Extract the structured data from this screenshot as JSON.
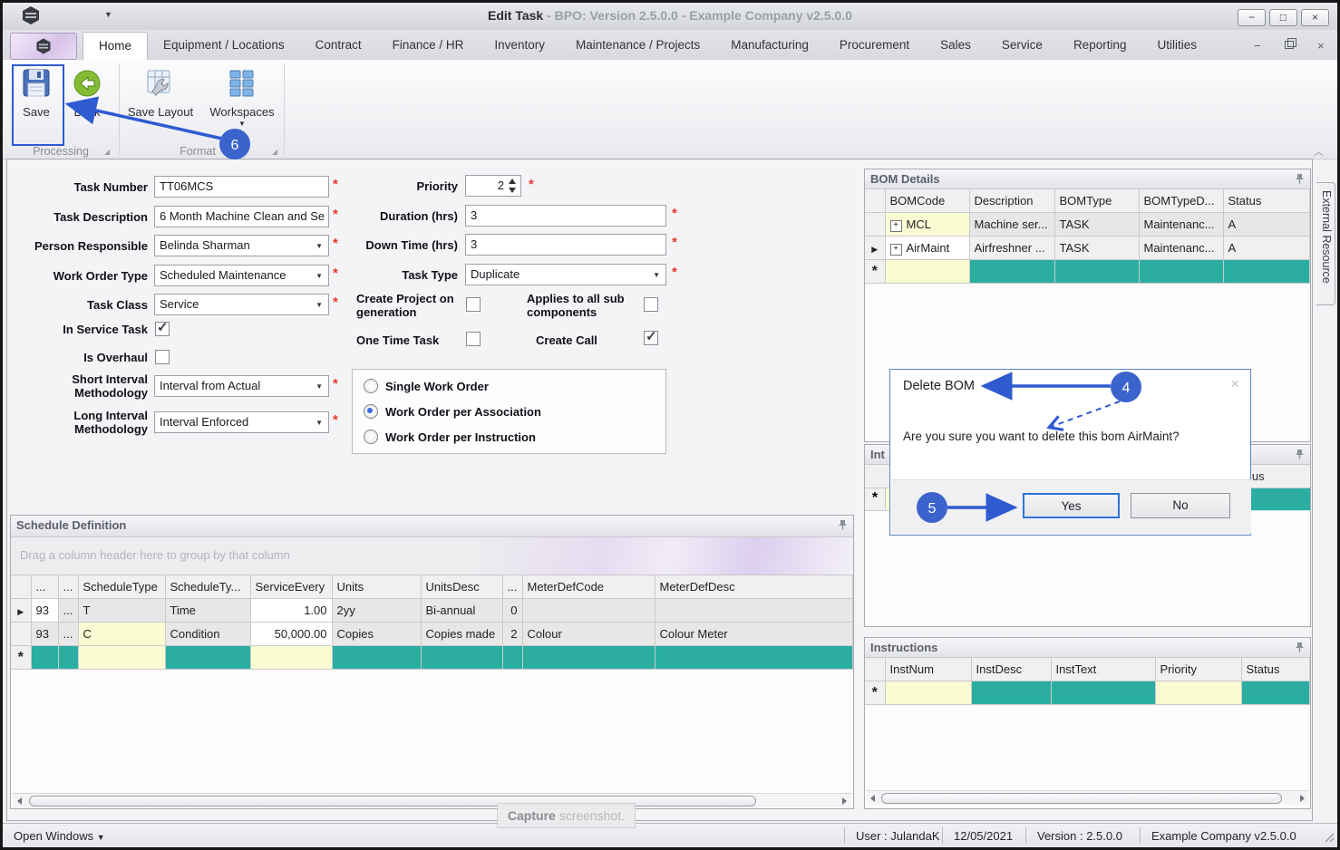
{
  "window": {
    "title_primary": "Edit Task",
    "title_rest": " - BPO: Version 2.5.0.0 - Example Company v2.5.0.0"
  },
  "ribbon": {
    "tabs": [
      "Home",
      "Equipment / Locations",
      "Contract",
      "Finance / HR",
      "Inventory",
      "Maintenance / Projects",
      "Manufacturing",
      "Procurement",
      "Sales",
      "Service",
      "Reporting",
      "Utilities"
    ],
    "active_tab": "Home",
    "save_label": "Save",
    "back_label": "Back",
    "save_layout_label": "Save Layout",
    "workspaces_label": "Workspaces",
    "group_processing": "Processing",
    "group_format": "Format"
  },
  "form": {
    "task_number": {
      "label": "Task Number",
      "value": "TT06MCS"
    },
    "task_description": {
      "label": "Task Description",
      "value": "6 Month Machine Clean and Se"
    },
    "person_responsible": {
      "label": "Person Responsible",
      "value": "Belinda Sharman"
    },
    "work_order_type": {
      "label": "Work Order Type",
      "value": "Scheduled Maintenance"
    },
    "task_class": {
      "label": "Task Class",
      "value": "Service"
    },
    "in_service_task": {
      "label": "In Service Task",
      "checked": true
    },
    "is_overhaul": {
      "label": "Is Overhaul",
      "checked": false
    },
    "short_interval": {
      "label": "Short Interval Methodology",
      "value": "Interval from Actual"
    },
    "long_interval": {
      "label": "Long Interval Methodology",
      "value": "Interval Enforced"
    },
    "priority": {
      "label": "Priority",
      "value": "2"
    },
    "duration": {
      "label": "Duration (hrs)",
      "value": "3"
    },
    "down_time": {
      "label": "Down Time (hrs)",
      "value": "3"
    },
    "task_type": {
      "label": "Task Type",
      "value": "Duplicate"
    },
    "create_project": {
      "label": "Create Project on generation",
      "checked": false
    },
    "applies_sub": {
      "label": "Applies to all sub components",
      "checked": false
    },
    "one_time": {
      "label": "One Time Task",
      "checked": false
    },
    "create_call": {
      "label": "Create Call",
      "checked": true
    },
    "radio_options": [
      "Single Work Order",
      "Work Order per Association",
      "Work Order per Instruction"
    ],
    "radio_selected": "Work Order per Association"
  },
  "bom": {
    "title": "BOM Details",
    "columns": [
      "BOMCode",
      "Description",
      "BOMType",
      "BOMTypeD...",
      "Status"
    ],
    "rows": [
      {
        "code": "MCL",
        "desc": "Machine ser...",
        "type": "TASK",
        "typedesc": "Maintenanc...",
        "status": "A"
      },
      {
        "code": "AirMaint",
        "desc": "Airfreshner ...",
        "type": "TASK",
        "typedesc": "Maintenanc...",
        "status": "A"
      }
    ]
  },
  "hidden_panel": {
    "title_fragment": "Int",
    "column_fragment": "...us"
  },
  "dialog": {
    "title": "Delete BOM",
    "message": "Are you sure you want to delete this bom AirMaint?",
    "yes_label": "Yes",
    "no_label": "No"
  },
  "schedule": {
    "title": "Schedule Definition",
    "group_hint": "Drag a column header here to group by that column",
    "columns": [
      "...",
      "...",
      "ScheduleType",
      "ScheduleTy...",
      "ServiceEvery",
      "Units",
      "UnitsDesc",
      "...",
      "MeterDefCode",
      "MeterDefDesc"
    ],
    "rows": [
      [
        "93",
        "...",
        "T",
        "Time",
        "1.00",
        "2yy",
        "Bi-annual",
        "0",
        "",
        ""
      ],
      [
        "93",
        "...",
        "C",
        "Condition",
        "50,000.00",
        "Copies",
        "Copies made",
        "2",
        "Colour",
        "Colour Meter"
      ]
    ]
  },
  "instructions": {
    "title": "Instructions",
    "columns": [
      "InstNum",
      "InstDesc",
      "InstText",
      "Priority",
      "Status"
    ]
  },
  "statusbar": {
    "open_windows": "Open Windows",
    "user": "User : JulandaK",
    "date": "12/05/2021",
    "version": "Version : 2.5.0.0",
    "company": "Example Company v2.5.0.0"
  },
  "capture": {
    "bold": "Capture",
    "rest": " screenshot."
  },
  "external_tab": "External Resource",
  "annotations": {
    "step4": "4",
    "step5": "5",
    "step6": "6"
  },
  "icons": {
    "dropdown": "▼",
    "check": "✓",
    "close": "×",
    "minimize": "−",
    "maximize": "□",
    "row_arrow": "▶",
    "new_row": "*",
    "plus": "+",
    "collapse_chevron": "︿"
  },
  "colors": {
    "teal_newrow": "#2BAEA1",
    "annotation_blue": "#2F5BD0",
    "key_cell_yellow": "#FBFBD3",
    "required_red": "#E23B2E"
  }
}
